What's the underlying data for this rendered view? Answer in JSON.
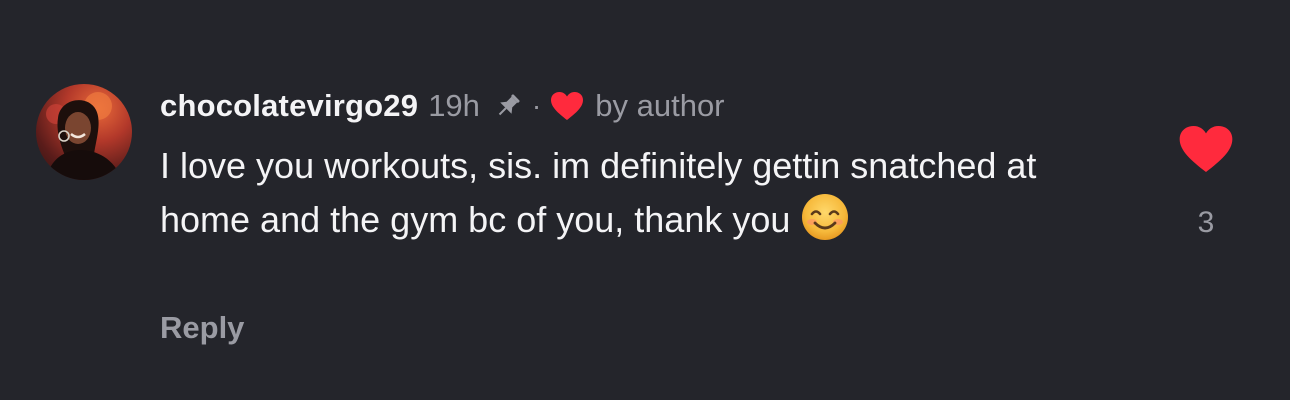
{
  "comment": {
    "username": "chocolatevirgo29",
    "time": "19h",
    "separator": "·",
    "author_liked_label": "by author",
    "text": "I love you workouts, sis. im definitely gettin snatched at home and the gym bc of you, thank you",
    "emoji": "smiling-face-with-smiling-eyes",
    "reply_label": "Reply",
    "like_count": "3",
    "pinned": true
  },
  "colors": {
    "background": "#24252b",
    "text_primary": "#f4f4f6",
    "text_secondary": "#9a9ba3",
    "heart_red": "#ff2a3d"
  },
  "icons": {
    "avatar": "user-avatar-photo",
    "pin": "pin-icon",
    "author_like": "heart-icon",
    "like": "heart-icon",
    "emoji": "smiling-face-emoji"
  }
}
